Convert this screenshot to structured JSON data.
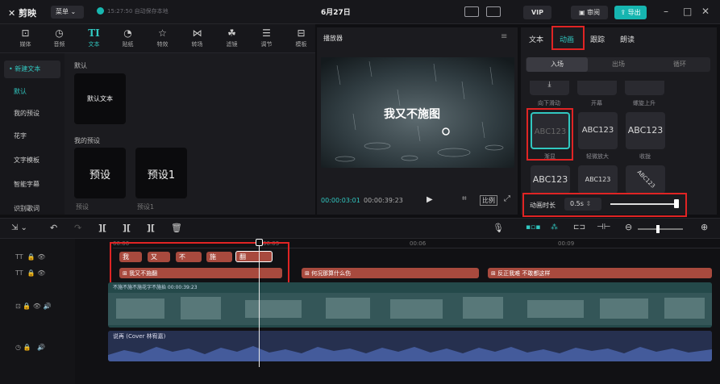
{
  "app": {
    "name": "剪映",
    "menu_label": "菜单",
    "save_status": "15:27:50 自动保存本地",
    "title": "6月27日",
    "vip_label": "VIP",
    "review_label": "审阅",
    "export_label": "导出"
  },
  "toolbar": [
    {
      "label": "媒体",
      "icon": "media-icon"
    },
    {
      "label": "音频",
      "icon": "audio-icon"
    },
    {
      "label": "文本",
      "icon": "text-icon"
    },
    {
      "label": "贴纸",
      "icon": "sticker-icon"
    },
    {
      "label": "特效",
      "icon": "effects-icon"
    },
    {
      "label": "转场",
      "icon": "transition-icon"
    },
    {
      "label": "滤镜",
      "icon": "filter-icon"
    },
    {
      "label": "调节",
      "icon": "adjust-icon"
    },
    {
      "label": "模板",
      "icon": "template-icon"
    }
  ],
  "left_nav": [
    "• 新建文本",
    "默认",
    "我的预设",
    "花字",
    "文字模板",
    "智能字幕",
    "识别歌词"
  ],
  "assets": {
    "default_heading": "默认",
    "default_card": "默认文本",
    "preset_heading": "我的预设",
    "presets": [
      {
        "card": "预设",
        "caption": "预设"
      },
      {
        "card": "预设1",
        "caption": "预设1"
      }
    ]
  },
  "player": {
    "title": "播放器",
    "subtitle": "我又不施图",
    "current_time": "00:00:03:01",
    "total_time": "00:00:39:23",
    "ratio_label": "比例"
  },
  "right_panel": {
    "tabs": [
      "文本",
      "动画",
      "跟踪",
      "朗读"
    ],
    "subtabs": [
      "入场",
      "出场",
      "循环"
    ],
    "top_row_labels": [
      "向下滑动",
      "开幕",
      "螺旋上升"
    ],
    "animations": [
      {
        "text": "ABC123",
        "label": "渐显"
      },
      {
        "text": "ABC123",
        "label": "轻微放大"
      },
      {
        "text": "ABC123",
        "label": "收拢"
      },
      {
        "text": "ABC123",
        "label": ""
      },
      {
        "text": "ABC123",
        "label": ""
      },
      {
        "text": "ABC123",
        "label": ""
      }
    ],
    "duration_label": "动画时长",
    "duration_value": "0.5s",
    "duration_fraction": 0.98
  },
  "timeline": {
    "ruler_marks": [
      "00:00",
      "00:03",
      "00:06",
      "00:09"
    ],
    "char_clips": [
      "我",
      "又",
      "不",
      "施",
      "翻"
    ],
    "text_clips": [
      "我又不施翻",
      "何况那算什么伤",
      "反正我难 不敢都这样"
    ],
    "video_label": "不施不施不施花字不施抬 00:00:39:23",
    "cover_label": "封面",
    "audio_label": "说再 (Cover 林宥嘉)"
  }
}
